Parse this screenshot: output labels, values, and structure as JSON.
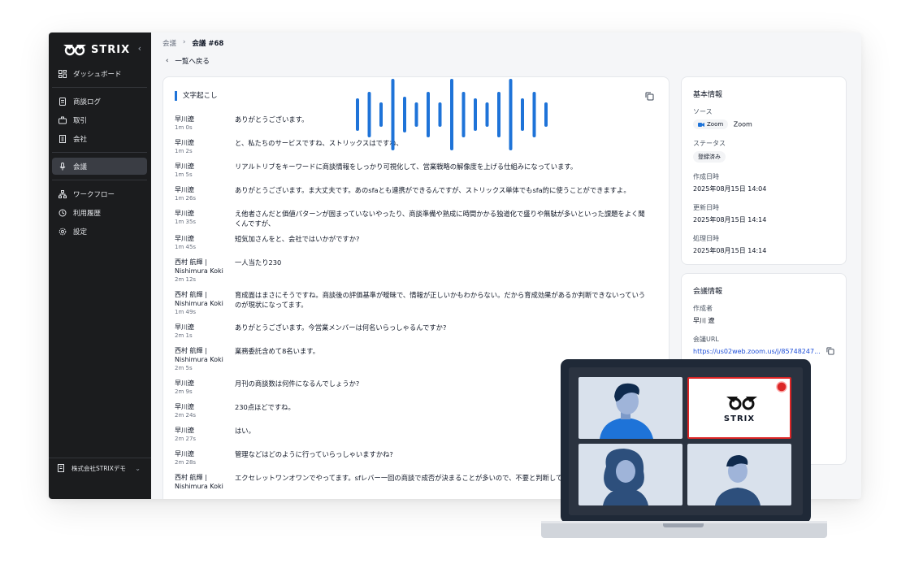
{
  "app": {
    "brand": "STRIX",
    "accent": "#1e73d8"
  },
  "sidebar": {
    "items": [
      {
        "label": "ダッシュボード",
        "icon": "dashboard-icon"
      },
      {
        "label": "商談ログ",
        "icon": "document-icon"
      },
      {
        "label": "取引",
        "icon": "briefcase-icon"
      },
      {
        "label": "会社",
        "icon": "building-icon"
      },
      {
        "label": "会議",
        "icon": "microphone-icon",
        "active": true
      },
      {
        "label": "ワークフロー",
        "icon": "workflow-icon"
      },
      {
        "label": "利用履歴",
        "icon": "history-icon"
      },
      {
        "label": "設定",
        "icon": "gear-icon"
      }
    ],
    "company": "株式会社STRIXデモ"
  },
  "breadcrumb": {
    "root": "会議",
    "current": "会議 #68"
  },
  "back_label": "一覧へ戻る",
  "transcript": {
    "title": "文字起こし",
    "rows": [
      {
        "speaker": "早川遼",
        "time": "1m 0s",
        "text": "ありがとうございます。"
      },
      {
        "speaker": "早川遼",
        "time": "1m 2s",
        "text": "と、私たちのサービスですね、ストリックスはですね、"
      },
      {
        "speaker": "早川遼",
        "time": "1m 5s",
        "text": "リアルトリブをキーワードに商談情報をしっかり可視化して、営業戦略の解像度を上げる仕組みになっています。"
      },
      {
        "speaker": "早川遼",
        "time": "1m 26s",
        "text": "ありがとうございます。ま大丈夫です。あのsfaとも連携ができるんですが、ストリックス単体でもsfa的に使うことができますよ。"
      },
      {
        "speaker": "早川遼",
        "time": "1m 35s",
        "text": "え他者さんだと価値パターンが固まっていないやったり、商談準備や熟成に時間かかる独道化で盛りや無駄が多いといった課題をよく聞くんですが、"
      },
      {
        "speaker": "早川遼",
        "time": "1m 45s",
        "text": "短気加さんをと、会社ではいかがですか?"
      },
      {
        "speaker": "西村 航輝 | Nishimura Koki",
        "time": "2m 12s",
        "text": "一人当たり230"
      },
      {
        "speaker": "西村 航輝 | Nishimura Koki",
        "time": "1m 49s",
        "text": "育成面はまさにそうですね。商談後の評価基準が曖昧で、情報が正しいかもわからない。だから育成効果があるか判断できないっていうのが現状になってます。"
      },
      {
        "speaker": "早川遼",
        "time": "2m 1s",
        "text": "ありがとうございます。今営業メンバーは何名いらっしゃるんですか?"
      },
      {
        "speaker": "西村 航輝 | Nishimura Koki",
        "time": "2m 5s",
        "text": "業務委託含めて8名います。"
      },
      {
        "speaker": "早川遼",
        "time": "2m 9s",
        "text": "月刊の商談数は何件になるんでしょうか?"
      },
      {
        "speaker": "早川遼",
        "time": "2m 24s",
        "text": "230点ほどですね。"
      },
      {
        "speaker": "早川遼",
        "time": "2m 27s",
        "text": "はい。"
      },
      {
        "speaker": "早川遼",
        "time": "2m 28s",
        "text": "管理などはどのように行っていらっしゃいますかね?"
      },
      {
        "speaker": "西村 航輝 | Nishimura Koki",
        "time": "",
        "text": "エクセレットワンオワンでやってます。sfレバー一回の商談で成否が決まることが多いので、不要と判断して"
      }
    ]
  },
  "basic_info": {
    "title": "基本情報",
    "source_label": "ソース",
    "source_chip": "Zoom",
    "source_value": "Zoom",
    "status_label": "ステータス",
    "status_value": "登録済み",
    "created_label": "作成日時",
    "created_value": "2025年08月15日 14:04",
    "updated_label": "更新日時",
    "updated_value": "2025年08月15日 14:14",
    "processed_label": "処理日時",
    "processed_value": "2025年08月15日 14:14"
  },
  "meeting_info": {
    "title": "会議情報",
    "creator_label": "作成者",
    "creator_value": "早川 遼",
    "url_label": "会議URL",
    "url_value": "https://us02web.zoom.us/j/85748247..."
  },
  "laptop": {
    "brand": "STRIX",
    "record_color": "#dc2626"
  }
}
